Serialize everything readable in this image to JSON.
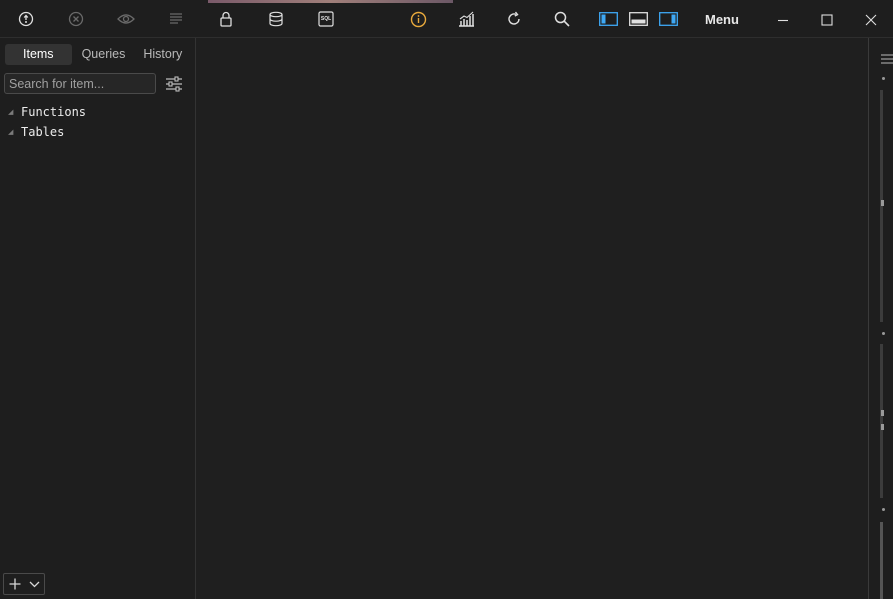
{
  "toolbar": {
    "icons": [
      "connect-icon",
      "disconnect-icon",
      "eye-icon",
      "align-icon",
      "lock-icon",
      "database-icon",
      "sql-icon",
      "info-icon",
      "chart-icon",
      "refresh-icon",
      "search-icon",
      "layout-left-icon",
      "layout-bottom-icon",
      "layout-right-icon"
    ],
    "sql_badge": "SQL",
    "menu_label": "Menu",
    "accent_color": "#3ea8f4",
    "info_color": "#e8a93c"
  },
  "window_controls": [
    "minimize-icon",
    "maximize-icon",
    "close-icon"
  ],
  "sidebar": {
    "tabs": [
      {
        "label": "Items",
        "active": true
      },
      {
        "label": "Queries",
        "active": false
      },
      {
        "label": "History",
        "active": false
      }
    ],
    "search": {
      "placeholder": "Search for item...",
      "value": ""
    },
    "tree": [
      {
        "label": "Functions"
      },
      {
        "label": "Tables"
      }
    ]
  }
}
